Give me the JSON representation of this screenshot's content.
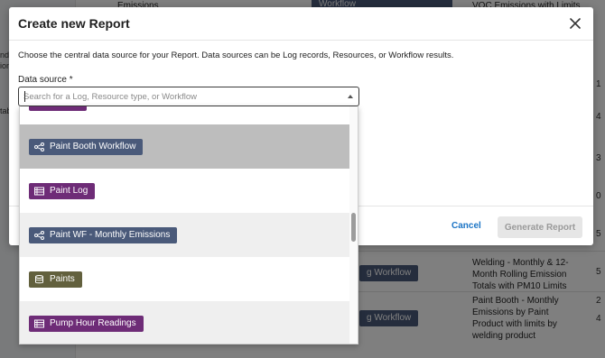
{
  "background": {
    "sidebar_texts": [
      "nd",
      "ions",
      "tab"
    ],
    "workflow_badge": "Workflow",
    "emissions_fragment": "Emissions",
    "top_right_text": "VOC Emissions with Limits",
    "row_badges": [
      "g Workflow",
      "g Workflow"
    ],
    "row_texts": [
      "Welding - Monthly & 12-Month Rolling Emission Totals with PM10 Limits",
      "Paint Booth - Monthly Emissions by Paint Product with limits by welding product"
    ],
    "right_numbers": [
      "1",
      "4",
      "3",
      "0",
      "5",
      "5",
      "2",
      "4"
    ]
  },
  "modal": {
    "title": "Create new Report",
    "description": "Choose the central data source for your Report. Data sources can be Log records, Resources, or Workflow results.",
    "field_label": "Data source *",
    "search_placeholder": "Search for a Log, Resource type, or Workflow",
    "search_value": "",
    "cancel_label": "Cancel",
    "generate_label": "Generate Report"
  },
  "dropdown": {
    "options": [
      {
        "label": "Paint Booth Workflow",
        "type": "workflow",
        "icon": "workflow-icon",
        "color": "#4a5a7a"
      },
      {
        "label": "Paint Log",
        "type": "log",
        "icon": "log-icon",
        "color": "#6e2c77"
      },
      {
        "label": "Paint WF - Monthly Emissions",
        "type": "workflow",
        "icon": "workflow-icon",
        "color": "#4a5a7a"
      },
      {
        "label": "Paints",
        "type": "resource",
        "icon": "database-icon",
        "color": "#62603d"
      },
      {
        "label": "Pump Hour Readings",
        "type": "log",
        "icon": "log-icon",
        "color": "#6e2c77"
      }
    ]
  },
  "colors": {
    "workflow": "#4a5a7a",
    "log": "#6e2c77",
    "resource": "#62603d",
    "link": "#1b74c5"
  }
}
